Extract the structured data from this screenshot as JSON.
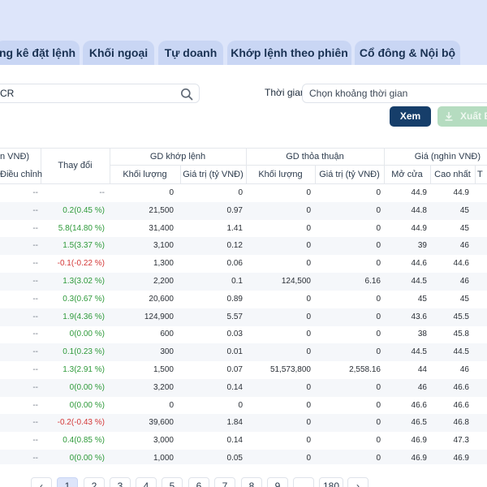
{
  "tabs": [
    "ng kê đặt lệnh",
    "Khối ngoại",
    "Tự doanh",
    "Khớp lệnh theo phiên",
    "Cổ đông & Nội bộ"
  ],
  "search": {
    "value": "CR"
  },
  "filters": {
    "time_label": "Thời gian",
    "time_placeholder": "Chọn khoảng thời gian"
  },
  "buttons": {
    "view": "Xem",
    "export": "Xuất E"
  },
  "table": {
    "headers": {
      "price_partial": "n VNĐ)",
      "adjusted": "Điều chỉnh",
      "change": "Thay đổi",
      "matched_group": "GD khớp lệnh",
      "deal_group": "GD thỏa thuận",
      "price_group": "Giá (nghìn VNĐ)",
      "volume": "Khối lượng",
      "value": "Giá trị (tỷ VNĐ)",
      "open": "Mở cửa",
      "high": "Cao nhất",
      "low_partial": "T"
    },
    "rows": [
      {
        "adj": "--",
        "chg": "--",
        "dir": "none",
        "mvol": "0",
        "mval": "0",
        "dvol": "0",
        "dval": "0",
        "open": "44.9",
        "high": "44.9"
      },
      {
        "adj": "--",
        "chg": "0.2(0.45 %)",
        "dir": "up",
        "mvol": "21,500",
        "mval": "0.97",
        "dvol": "0",
        "dval": "0",
        "open": "44.8",
        "high": "45"
      },
      {
        "adj": "--",
        "chg": "5.8(14.80 %)",
        "dir": "up",
        "mvol": "31,400",
        "mval": "1.41",
        "dvol": "0",
        "dval": "0",
        "open": "44.9",
        "high": "45"
      },
      {
        "adj": "--",
        "chg": "1.5(3.37 %)",
        "dir": "up",
        "mvol": "3,100",
        "mval": "0.12",
        "dvol": "0",
        "dval": "0",
        "open": "39",
        "high": "46"
      },
      {
        "adj": "--",
        "chg": "-0.1(-0.22 %)",
        "dir": "down",
        "mvol": "1,300",
        "mval": "0.06",
        "dvol": "0",
        "dval": "0",
        "open": "44.6",
        "high": "44.6"
      },
      {
        "adj": "--",
        "chg": "1.3(3.02 %)",
        "dir": "up",
        "mvol": "2,200",
        "mval": "0.1",
        "dvol": "124,500",
        "dval": "6.16",
        "open": "44.5",
        "high": "46"
      },
      {
        "adj": "--",
        "chg": "0.3(0.67 %)",
        "dir": "up",
        "mvol": "20,600",
        "mval": "0.89",
        "dvol": "0",
        "dval": "0",
        "open": "45",
        "high": "45"
      },
      {
        "adj": "--",
        "chg": "1.9(4.36 %)",
        "dir": "up",
        "mvol": "124,900",
        "mval": "5.57",
        "dvol": "0",
        "dval": "0",
        "open": "43.6",
        "high": "45.5"
      },
      {
        "adj": "--",
        "chg": "0(0.00 %)",
        "dir": "up",
        "mvol": "600",
        "mval": "0.03",
        "dvol": "0",
        "dval": "0",
        "open": "38",
        "high": "45.8"
      },
      {
        "adj": "--",
        "chg": "0.1(0.23 %)",
        "dir": "up",
        "mvol": "300",
        "mval": "0.01",
        "dvol": "0",
        "dval": "0",
        "open": "44.5",
        "high": "44.5"
      },
      {
        "adj": "--",
        "chg": "1.3(2.91 %)",
        "dir": "up",
        "mvol": "1,500",
        "mval": "0.07",
        "dvol": "51,573,800",
        "dval": "2,558.16",
        "open": "44",
        "high": "46"
      },
      {
        "adj": "--",
        "chg": "0(0.00 %)",
        "dir": "up",
        "mvol": "3,200",
        "mval": "0.14",
        "dvol": "0",
        "dval": "0",
        "open": "46",
        "high": "46.6"
      },
      {
        "adj": "--",
        "chg": "0(0.00 %)",
        "dir": "up",
        "mvol": "0",
        "mval": "0",
        "dvol": "0",
        "dval": "0",
        "open": "46.6",
        "high": "46.6"
      },
      {
        "adj": "--",
        "chg": "-0.2(-0.43 %)",
        "dir": "down",
        "mvol": "39,600",
        "mval": "1.84",
        "dvol": "0",
        "dval": "0",
        "open": "46.5",
        "high": "46.8"
      },
      {
        "adj": "--",
        "chg": "0.4(0.85 %)",
        "dir": "up",
        "mvol": "3,000",
        "mval": "0.14",
        "dvol": "0",
        "dval": "0",
        "open": "46.9",
        "high": "47.3"
      },
      {
        "adj": "--",
        "chg": "0(0.00 %)",
        "dir": "up",
        "mvol": "1,000",
        "mval": "0.05",
        "dvol": "0",
        "dval": "0",
        "open": "46.9",
        "high": "46.9"
      }
    ]
  },
  "pagination": {
    "prev": "‹",
    "pages": [
      "1",
      "2",
      "3",
      "4",
      "5",
      "6",
      "7",
      "8",
      "9",
      "...",
      "180"
    ],
    "next": "›",
    "current": "1"
  },
  "colors": {
    "accent": "#163e6a",
    "positive": "#2e9a3a",
    "negative": "#d43838",
    "export_disabled": "#b5dcc0",
    "tab_bg": "#c9d6f4"
  }
}
